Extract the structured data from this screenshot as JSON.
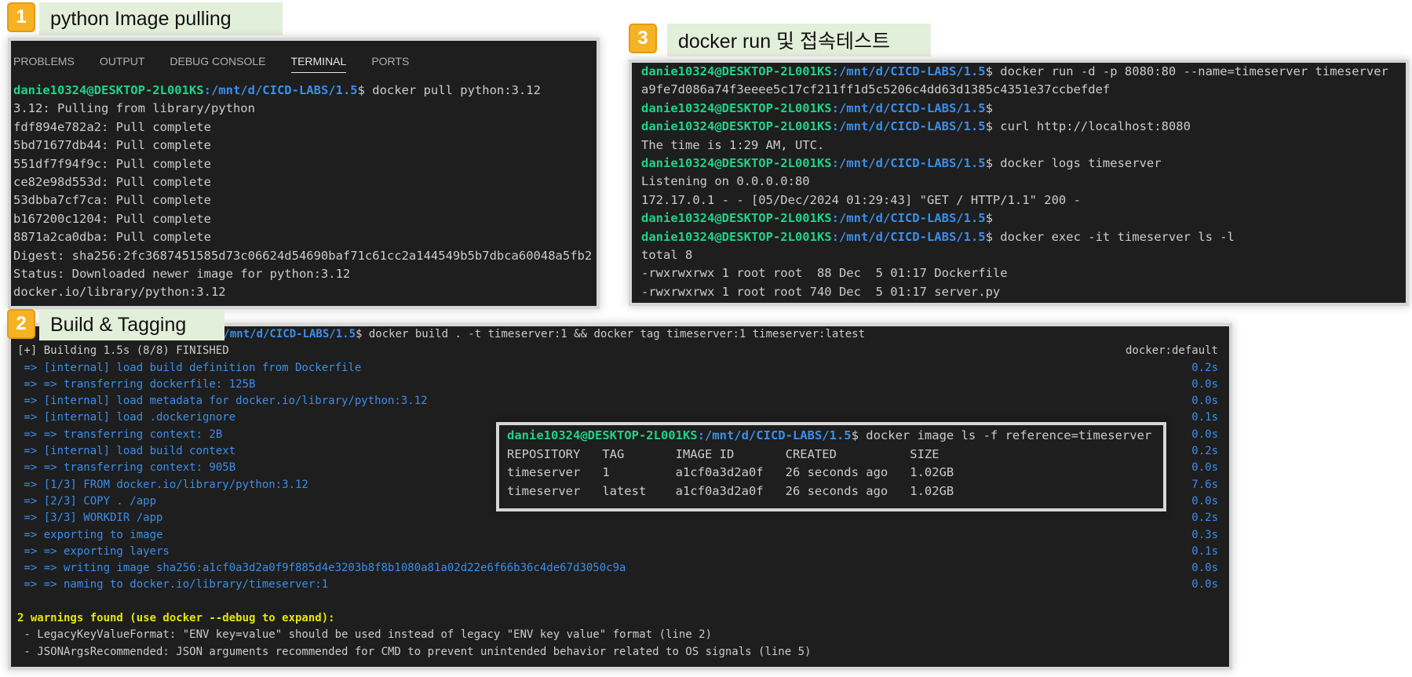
{
  "sections": {
    "s1": {
      "num": "1",
      "title": "python Image pulling"
    },
    "s2": {
      "num": "2",
      "title": "Build & Tagging"
    },
    "s3": {
      "num": "3",
      "title": "docker run 및 접속테스트"
    }
  },
  "panel1": {
    "tabs": [
      "PROBLEMS",
      "OUTPUT",
      "DEBUG CONSOLE",
      "TERMINAL",
      "PORTS"
    ],
    "active_tab": "TERMINAL",
    "prompt_user": "danie10324@DESKTOP-2L001KS",
    "prompt_path": ":/mnt/d/CICD-LABS/1.5",
    "cmd": "$ docker pull python:3.12",
    "output": [
      "3.12: Pulling from library/python",
      "fdf894e782a2: Pull complete",
      "5bd71677db44: Pull complete",
      "551df7f94f9c: Pull complete",
      "ce82e98d553d: Pull complete",
      "53dbba7cf7ca: Pull complete",
      "b167200c1204: Pull complete",
      "8871a2ca0dba: Pull complete",
      "Digest: sha256:2fc3687451585d73c06624d54690baf71c61cc2a144549b5b7dbca60048a5fb2",
      "Status: Downloaded newer image for python:3.12",
      "docker.io/library/python:3.12"
    ]
  },
  "panel3": {
    "prompt_user": "danie10324@DESKTOP-2L001KS",
    "prompt_path": ":/mnt/d/CICD-LABS/1.5",
    "cmd_run": "$ docker run -d -p 8080:80 --name=timeserver timeserver",
    "out_run": "a9fe7d086a74f3eeee5c17cf211ff1d5c5206c4dd63d1385c4351e37ccbefdef",
    "cmd_empty": "$",
    "cmd_curl": "$ curl http://localhost:8080",
    "out_curl": "The time is 1:29 AM, UTC.",
    "cmd_logs": "$ docker logs timeserver",
    "out_logs_1": "Listening on 0.0.0.0:80",
    "out_logs_2": "172.17.0.1 - - [05/Dec/2024 01:29:43] \"GET / HTTP/1.1\" 200 -",
    "cmd_exec": "$ docker exec -it timeserver ls -l",
    "out_exec": [
      "total 8",
      "-rwxrwxrwx 1 root root  88 Dec  5 01:17 Dockerfile",
      "-rwxrwxrwx 1 root root 740 Dec  5 01:17 server.py"
    ]
  },
  "panel2": {
    "prompt_path_partial": "l/mnt/d/CICD-LABS/1.5",
    "cmd": "$ docker build . -t timeserver:1 && docker tag timeserver:1 timeserver:latest",
    "building": "[+] Building 1.5s (8/8) FINISHED",
    "builder": "docker:default",
    "steps": [
      {
        "text": " => [internal] load build definition from Dockerfile",
        "time": "0.2s"
      },
      {
        "text": " => => transferring dockerfile: 125B",
        "time": "0.0s"
      },
      {
        "text": " => [internal] load metadata for docker.io/library/python:3.12",
        "time": "0.0s"
      },
      {
        "text": " => [internal] load .dockerignore",
        "time": "0.1s"
      },
      {
        "text": " => => transferring context: 2B",
        "time": "0.0s"
      },
      {
        "text": " => [internal] load build context",
        "time": "0.2s"
      },
      {
        "text": " => => transferring context: 905B",
        "time": "0.0s"
      },
      {
        "text": " => [1/3] FROM docker.io/library/python:3.12",
        "time": "7.6s"
      },
      {
        "text": " => [2/3] COPY . /app",
        "time": "0.0s"
      },
      {
        "text": " => [3/3] WORKDIR /app",
        "time": "0.2s"
      },
      {
        "text": " => exporting to image",
        "time": "0.3s"
      },
      {
        "text": " => => exporting layers",
        "time": "0.1s"
      },
      {
        "text": " => => writing image sha256:a1cf0a3d2a0f9f885d4e3203b8f8b1080a81a02d22e6f66b36c4de67d3050c9a",
        "time": "0.0s"
      },
      {
        "text": " => => naming to docker.io/library/timeserver:1",
        "time": "0.0s"
      }
    ],
    "warnings_header": "2 warnings found (use docker --debug to expand):",
    "warnings": [
      " - LegacyKeyValueFormat: \"ENV key=value\" should be used instead of legacy \"ENV key value\" format (line 2)",
      " - JSONArgsRecommended: JSON arguments recommended for CMD to prevent unintended behavior related to OS signals (line 5)"
    ]
  },
  "panel4": {
    "prompt_user": "danie10324@DESKTOP-2L001KS",
    "prompt_path": ":/mnt/d/CICD-LABS/1.5",
    "cmd": "$ docker image ls -f reference=timeserver",
    "header": "REPOSITORY   TAG       IMAGE ID       CREATED          SIZE",
    "rows": [
      "timeserver   1         a1cf0a3d2a0f   26 seconds ago   1.02GB",
      "timeserver   latest    a1cf0a3d2a0f   26 seconds ago   1.02GB"
    ]
  }
}
